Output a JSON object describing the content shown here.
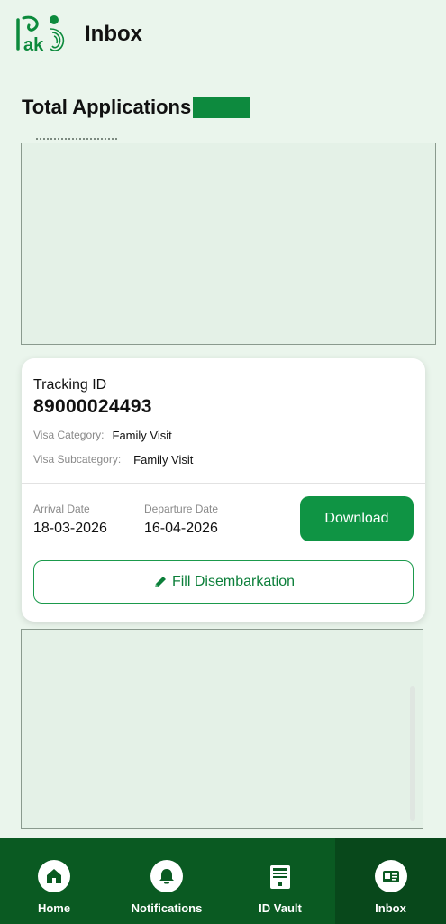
{
  "header": {
    "title": "Inbox",
    "logo_icon": "pak-identity-logo",
    "logo_text": "ak"
  },
  "summary": {
    "title": "Total Applications"
  },
  "application": {
    "tracking_label": "Tracking ID",
    "tracking_id": "89000024493",
    "visa_category_label": "Visa Category:",
    "visa_category": "Family Visit",
    "visa_subcategory_label": "Visa Subcategory:",
    "visa_subcategory": "Family Visit",
    "arrival_label": "Arrival Date",
    "arrival_date": "18-03-2026",
    "departure_label": "Departure Date",
    "departure_date": "16-04-2026",
    "download_label": "Download",
    "fill_label": "Fill Disembarkation"
  },
  "nav": {
    "items": [
      {
        "label": "Home",
        "icon": "home-icon"
      },
      {
        "label": "Notifications",
        "icon": "bell-icon"
      },
      {
        "label": "ID Vault",
        "icon": "id-vault-icon"
      },
      {
        "label": "Inbox",
        "icon": "inbox-card-icon",
        "active": true
      }
    ]
  },
  "colors": {
    "background": "#eaf5ec",
    "brand_green": "#0f9444",
    "nav_bg": "#0a5a22",
    "nav_active": "#08481b",
    "redaction": "#0d8a3e"
  }
}
